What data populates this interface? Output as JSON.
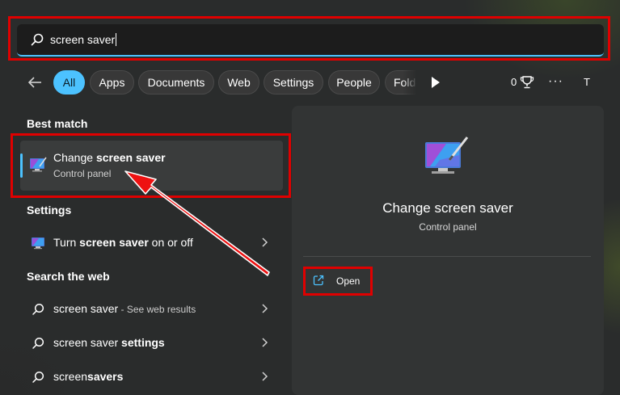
{
  "search": {
    "value": "screen saver",
    "accent_color": "#4cc2ff"
  },
  "filters": {
    "chips": [
      {
        "label": "All",
        "active": true
      },
      {
        "label": "Apps"
      },
      {
        "label": "Documents"
      },
      {
        "label": "Web"
      },
      {
        "label": "Settings"
      },
      {
        "label": "People"
      },
      {
        "label": "Folders"
      }
    ],
    "points": "0",
    "avatar_initial": "T",
    "more_label": "···"
  },
  "best_match": {
    "heading": "Best match",
    "title_prefix": "Change ",
    "title_bold": "screen saver",
    "subtitle": "Control panel"
  },
  "settings": {
    "heading": "Settings",
    "items": [
      {
        "prefix": "Turn ",
        "bold": "screen saver",
        "suffix": " on or off",
        "icon": "screen-saver-settings-icon"
      }
    ]
  },
  "web": {
    "heading": "Search the web",
    "items": [
      {
        "prefix": "screen saver",
        "hint": " - See web results",
        "bold": "",
        "icon": "search-icon"
      },
      {
        "prefix": "screen saver ",
        "hint": "",
        "bold": "settings",
        "icon": "search-icon"
      },
      {
        "prefix": "screen",
        "hint": "",
        "bold": "savers",
        "icon": "search-icon"
      }
    ]
  },
  "preview": {
    "title": "Change screen saver",
    "subtitle": "Control panel",
    "action_label": "Open"
  },
  "colors": {
    "highlight_red": "#e00000",
    "accent_blue": "#4cc2ff"
  }
}
